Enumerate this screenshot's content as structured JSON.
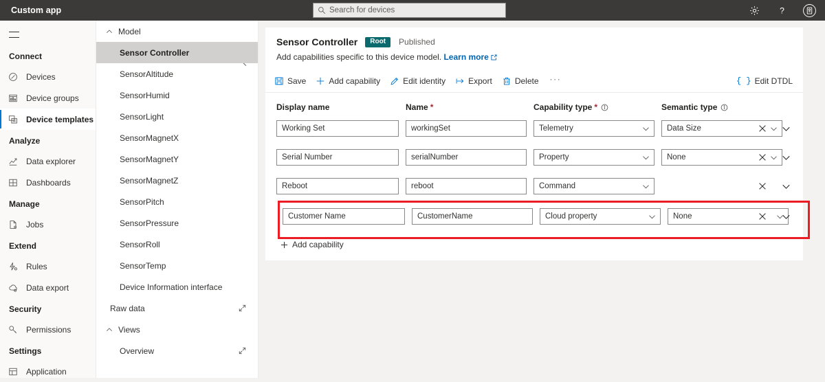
{
  "topbar": {
    "title": "Custom app",
    "search_placeholder": "Search for devices",
    "icons": {
      "search": "search-icon",
      "settings": "gear-icon",
      "help": "help-icon",
      "account": "account-icon"
    }
  },
  "leftnav": {
    "menu_label": "hamburger-menu",
    "groups": [
      {
        "label": "Connect",
        "items": [
          {
            "label": "Devices",
            "icon": "devices-icon",
            "selected": false
          },
          {
            "label": "Device groups",
            "icon": "device-groups-icon",
            "selected": false
          },
          {
            "label": "Device templates",
            "icon": "device-templates-icon",
            "selected": true
          }
        ]
      },
      {
        "label": "Analyze",
        "items": [
          {
            "label": "Data explorer",
            "icon": "data-explorer-icon",
            "selected": false
          },
          {
            "label": "Dashboards",
            "icon": "dashboards-icon",
            "selected": false
          }
        ]
      },
      {
        "label": "Manage",
        "items": [
          {
            "label": "Jobs",
            "icon": "jobs-icon",
            "selected": false
          }
        ]
      },
      {
        "label": "Extend",
        "items": [
          {
            "label": "Rules",
            "icon": "rules-icon",
            "selected": false
          },
          {
            "label": "Data export",
            "icon": "data-export-icon",
            "selected": false
          }
        ]
      },
      {
        "label": "Security",
        "items": [
          {
            "label": "Permissions",
            "icon": "permissions-key-icon",
            "selected": false
          }
        ]
      },
      {
        "label": "Settings",
        "items": [
          {
            "label": "Application",
            "icon": "application-icon",
            "selected": false
          }
        ]
      }
    ]
  },
  "midpanel": {
    "sections": [
      {
        "label": "Model",
        "expanded": true,
        "items": [
          {
            "label": "Sensor Controller",
            "selected": true,
            "indent": 2,
            "external": false
          },
          {
            "label": "SensorAltitude",
            "selected": false,
            "indent": 2,
            "external": false
          },
          {
            "label": "SensorHumid",
            "selected": false,
            "indent": 2,
            "external": false
          },
          {
            "label": "SensorLight",
            "selected": false,
            "indent": 2,
            "external": false
          },
          {
            "label": "SensorMagnetX",
            "selected": false,
            "indent": 2,
            "external": false
          },
          {
            "label": "SensorMagnetY",
            "selected": false,
            "indent": 2,
            "external": false
          },
          {
            "label": "SensorMagnetZ",
            "selected": false,
            "indent": 2,
            "external": false
          },
          {
            "label": "SensorPitch",
            "selected": false,
            "indent": 2,
            "external": false
          },
          {
            "label": "SensorPressure",
            "selected": false,
            "indent": 2,
            "external": false
          },
          {
            "label": "SensorRoll",
            "selected": false,
            "indent": 2,
            "external": false
          },
          {
            "label": "SensorTemp",
            "selected": false,
            "indent": 2,
            "external": false
          },
          {
            "label": "Device Information interface",
            "selected": false,
            "indent": 2,
            "external": false
          },
          {
            "label": "Raw data",
            "selected": false,
            "indent": 1,
            "external": true
          }
        ]
      },
      {
        "label": "Views",
        "expanded": true,
        "items": [
          {
            "label": "Overview",
            "selected": false,
            "indent": 2,
            "external": true
          }
        ]
      }
    ],
    "collapse_label": "collapse-panel"
  },
  "main": {
    "title": "Sensor Controller",
    "badge": "Root",
    "status": "Published",
    "subtitle": "Add capabilities specific to this device model.",
    "learn_more": "Learn more",
    "toolbar": [
      {
        "label": "Save",
        "icon": "save-icon"
      },
      {
        "label": "Add capability",
        "icon": "plus-icon"
      },
      {
        "label": "Edit identity",
        "icon": "pencil-icon"
      },
      {
        "label": "Export",
        "icon": "export-icon"
      },
      {
        "label": "Delete",
        "icon": "trash-icon"
      }
    ],
    "more_label": "···",
    "edit_dtdl": {
      "label": "Edit DTDL",
      "icon": "braces-icon"
    },
    "columns": [
      {
        "label": "Display name",
        "required": false,
        "info": false
      },
      {
        "label": "Name",
        "required": true,
        "info": false
      },
      {
        "label": "Capability type",
        "required": true,
        "info": true
      },
      {
        "label": "Semantic type",
        "required": false,
        "info": true
      }
    ],
    "rows": [
      {
        "display_name": "Working Set",
        "name": "workingSet",
        "capability_type": "Telemetry",
        "semantic_type": "Data Size",
        "has_semantic": true,
        "highlighted": false
      },
      {
        "display_name": "Serial Number",
        "name": "serialNumber",
        "capability_type": "Property",
        "semantic_type": "None",
        "has_semantic": true,
        "highlighted": false
      },
      {
        "display_name": "Reboot",
        "name": "reboot",
        "capability_type": "Command",
        "semantic_type": "",
        "has_semantic": false,
        "highlighted": false
      },
      {
        "display_name": "Customer Name",
        "name": "CustomerName",
        "capability_type": "Cloud property",
        "semantic_type": "None",
        "has_semantic": true,
        "highlighted": true
      }
    ],
    "row_actions": {
      "delete": "close-icon",
      "expand": "chevron-down-icon"
    },
    "add_capability": "Add capability",
    "highlight_color": "#ed1c24"
  }
}
